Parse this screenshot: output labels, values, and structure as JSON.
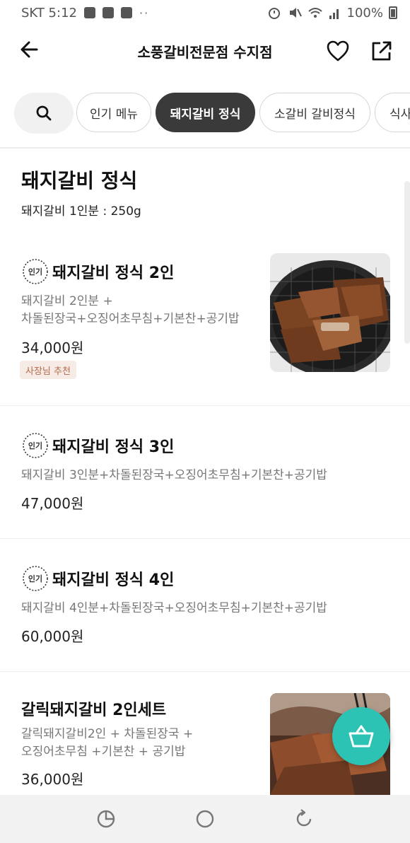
{
  "status": {
    "carrier_time": "SKT 5:12",
    "battery": "100%",
    "dots": "··"
  },
  "header": {
    "title": "소풍갈비전문점 수지점"
  },
  "tabs": [
    {
      "label": "인기 메뉴"
    },
    {
      "label": "돼지갈비 정식",
      "active": true
    },
    {
      "label": "소갈비 갈비정식"
    },
    {
      "label": "식사"
    }
  ],
  "section": {
    "title": "돼지갈비 정식",
    "subtitle": "돼지갈비 1인분 : 250g"
  },
  "badge_label": "인기",
  "items": [
    {
      "name": "돼지갈비 정식 2인",
      "desc_line1": "돼지갈비 2인분 +",
      "desc_line2": "차돌된장국+오징어초무침+기본찬+공기밥",
      "price": "34,000원",
      "tag": "사장님 추천",
      "popular": true
    },
    {
      "name": "돼지갈비 정식 3인",
      "desc_line1": "돼지갈비 3인분+차돌된장국+오징어초무침+기본찬+공기밥",
      "price": "47,000원",
      "popular": true
    },
    {
      "name": "돼지갈비 정식 4인",
      "desc_line1": "돼지갈비 4인분+차돌된장국+오징어초무침+기본찬+공기밥",
      "price": "60,000원",
      "popular": true
    },
    {
      "name": "갈릭돼지갈비 2인세트",
      "desc_line1": "갈릭돼지갈비2인 + 차돌된장국 +",
      "desc_line2": "오징어초무침 +기본찬 + 공기밥",
      "price": "36,000원",
      "popular": false
    }
  ],
  "colors": {
    "accent": "#2cc3b5",
    "tab_active": "#3a3a3a",
    "tag_bg": "#f6ece5",
    "tag_text": "#b56a4a"
  },
  "icons": [
    "back-arrow-icon",
    "heart-icon",
    "share-icon",
    "search-icon",
    "basket-icon",
    "recent-apps-icon",
    "home-icon",
    "back-nav-icon"
  ]
}
